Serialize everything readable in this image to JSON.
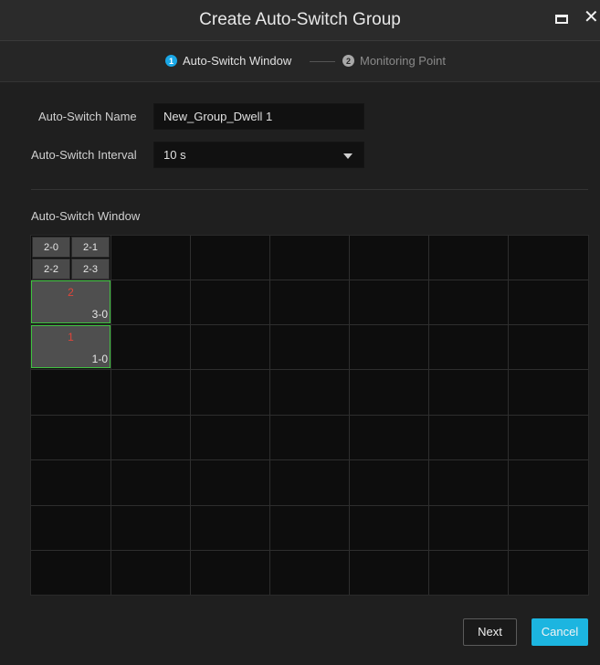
{
  "window": {
    "title": "Create Auto-Switch Group",
    "maximize_icon": "maximize-icon",
    "close_icon": "close-icon",
    "close_glyph": "✕"
  },
  "steps": [
    {
      "number": "1",
      "label": "Auto-Switch Window",
      "active": true
    },
    {
      "number": "2",
      "label": "Monitoring Point",
      "active": false
    }
  ],
  "form": {
    "name_label": "Auto-Switch Name",
    "name_value": "New_Group_Dwell 1",
    "interval_label": "Auto-Switch Interval",
    "interval_value": "10 s"
  },
  "section": {
    "window_title": "Auto-Switch Window"
  },
  "grid": {
    "columns": 7,
    "rows": 8,
    "mini_cells": [
      "2-0",
      "2-1",
      "2-2",
      "2-3"
    ],
    "windows": [
      {
        "order": "2",
        "id": "3-0"
      },
      {
        "order": "1",
        "id": "1-0"
      }
    ]
  },
  "buttons": {
    "next": "Next",
    "cancel": "Cancel"
  },
  "colors": {
    "accent": "#1aa7e6",
    "cancel_bg": "#1cb5e0",
    "selected_border": "#3ec33e",
    "order_text": "#e0463a"
  }
}
